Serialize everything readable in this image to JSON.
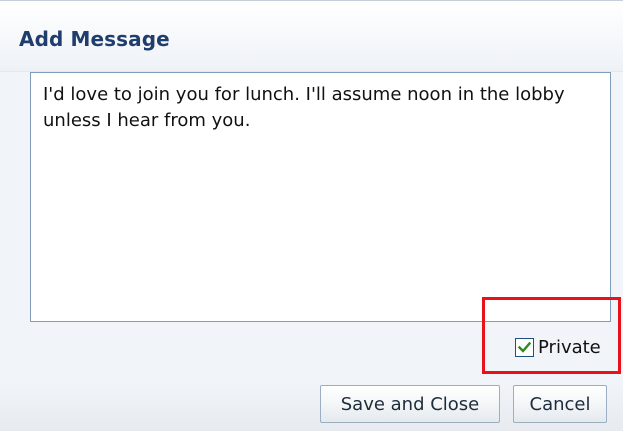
{
  "dialog": {
    "title": "Add Message",
    "message_text": "I'd love to join you for lunch. I'll assume noon in the lobby unless I hear from you.",
    "private_checkbox": {
      "label": "Private",
      "checked": true
    },
    "buttons": {
      "save_close_label": "Save and Close",
      "cancel_label": "Cancel"
    },
    "colors": {
      "title": "#1f3e6d",
      "highlight": "#e8121b",
      "checkmark": "#2e8b1e",
      "checkbox_border": "#1c5180",
      "textarea_border": "#7f9db9"
    }
  }
}
